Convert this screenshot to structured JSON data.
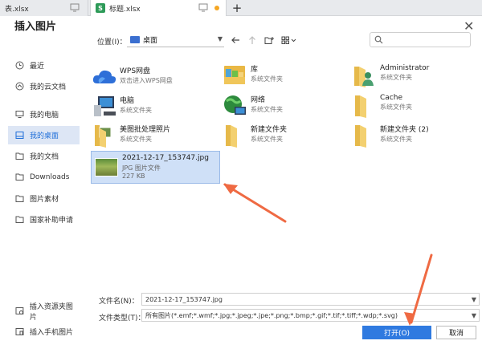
{
  "tabs": [
    {
      "label": "表.xlsx"
    },
    {
      "label": "标题.xlsx",
      "badge": "S"
    }
  ],
  "dialog": {
    "title": "插入图片",
    "close_label": "✕"
  },
  "sidebar": {
    "items": [
      {
        "label": "最近",
        "icon": "clock-icon"
      },
      {
        "label": "我的云文档",
        "icon": "cloud-icon"
      },
      {
        "label": "我的电脑",
        "icon": "monitor-icon"
      },
      {
        "label": "我的桌面",
        "icon": "desktop-icon",
        "active": true
      },
      {
        "label": "我的文档",
        "icon": "document-icon"
      },
      {
        "label": "Downloads",
        "icon": "folder-icon"
      },
      {
        "label": "图片素材",
        "icon": "folder-icon"
      },
      {
        "label": "国家补助申请",
        "icon": "folder-icon"
      }
    ],
    "bottom": [
      {
        "label": "插入资源夹图片",
        "icon": "resource-folder-icon"
      },
      {
        "label": "插入手机图片",
        "icon": "phone-icon"
      }
    ]
  },
  "toolbar": {
    "location_label": "位置(I)：",
    "location_value": "桌面"
  },
  "files": [
    {
      "name": "WPS网盘",
      "type": "双击进入WPS网盘",
      "icon": "cloud-drive-icon"
    },
    {
      "name": "库",
      "type": "系统文件夹",
      "icon": "library-icon"
    },
    {
      "name": "Administrator",
      "type": "系统文件夹",
      "icon": "user-folder-icon"
    },
    {
      "name": "电脑",
      "type": "系统文件夹",
      "icon": "computer-icon"
    },
    {
      "name": "网络",
      "type": "系统文件夹",
      "icon": "network-icon"
    },
    {
      "name": "Cache",
      "type": "系统文件夹",
      "icon": "folder-icon"
    },
    {
      "name": "美图批处理照片",
      "type": "系统文件夹",
      "icon": "photo-folder-icon"
    },
    {
      "name": "新建文件夹",
      "type": "系统文件夹",
      "icon": "folder-icon"
    },
    {
      "name": "新建文件夹 (2)",
      "type": "系统文件夹",
      "icon": "folder-icon"
    }
  ],
  "selected_file": {
    "name": "2021-12-17_153747.jpg",
    "type": "JPG 图片文件",
    "size": "227 KB"
  },
  "bottom": {
    "filename_label": "文件名(N)：",
    "filename_value": "2021-12-17_153747.jpg",
    "filetype_label": "文件类型(T)：",
    "filetype_value": "所有图片(*.emf;*.wmf;*.jpg;*.jpeg;*.jpe;*.png;*.bmp;*.gif;*.tif;*.tiff;*.wdp;*.svg)",
    "open_label": "打开(O)",
    "cancel_label": "取消"
  },
  "colors": {
    "accent": "#2f7ae0",
    "annotation_arrow": "#ef6a43",
    "folder": "#f0c14b"
  }
}
